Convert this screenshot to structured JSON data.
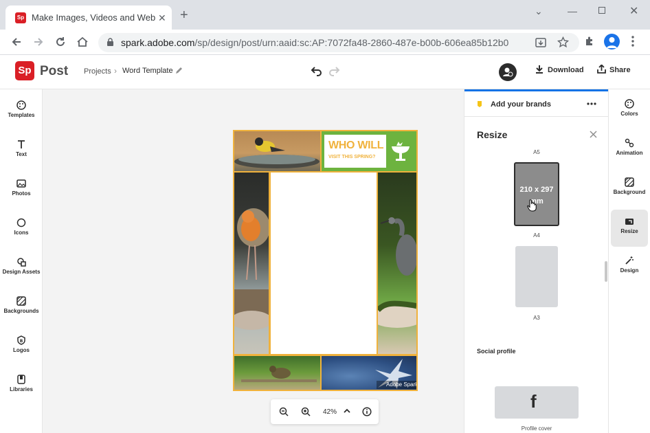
{
  "browser": {
    "tab_title": "Make Images, Videos and Web St",
    "url_host": "spark.adobe.com",
    "url_path": "/sp/design/post/urn:aaid:sc:AP:7072fa48-2860-487e-b00b-606ea85b12b0"
  },
  "app": {
    "logo": "Sp",
    "product": "Post",
    "breadcrumb_root": "Projects",
    "breadcrumb_current": "Word Template",
    "download_label": "Download",
    "share_label": "Share"
  },
  "left_rail": [
    {
      "label": "Templates",
      "icon": "palette-icon"
    },
    {
      "label": "Text",
      "icon": "text-icon"
    },
    {
      "label": "Photos",
      "icon": "photo-icon"
    },
    {
      "label": "Icons",
      "icon": "icons-icon"
    },
    {
      "label": "Design Assets",
      "icon": "shapes-icon"
    },
    {
      "label": "Backgrounds",
      "icon": "hatch-icon"
    },
    {
      "label": "Logos",
      "icon": "logo-icon"
    },
    {
      "label": "Libraries",
      "icon": "library-icon"
    }
  ],
  "design": {
    "headline_line1": "WHO WILL",
    "headline_line2": "VISIT THIS SPRING?",
    "watermark": "Adobe Spark",
    "colors": {
      "border": "#f0b23c",
      "green": "#6db33f"
    }
  },
  "zoom": {
    "level": "42%"
  },
  "panel": {
    "brands_label": "Add your brands",
    "title": "Resize",
    "partial_label": "A5",
    "a4_text": "210 x 297 mm",
    "a4_label": "A4",
    "a3_label": "A3",
    "section_social": "Social profile",
    "fb_glyph": "f",
    "profile_cover_label": "Profile cover"
  },
  "right_rail": [
    {
      "label": "Colors",
      "icon": "palette-icon",
      "active": false
    },
    {
      "label": "Animation",
      "icon": "animation-icon",
      "active": false
    },
    {
      "label": "Background",
      "icon": "hatch-icon",
      "active": false
    },
    {
      "label": "Resize",
      "icon": "resize-icon",
      "active": true
    },
    {
      "label": "Design",
      "icon": "magic-wand-icon",
      "active": false
    }
  ]
}
